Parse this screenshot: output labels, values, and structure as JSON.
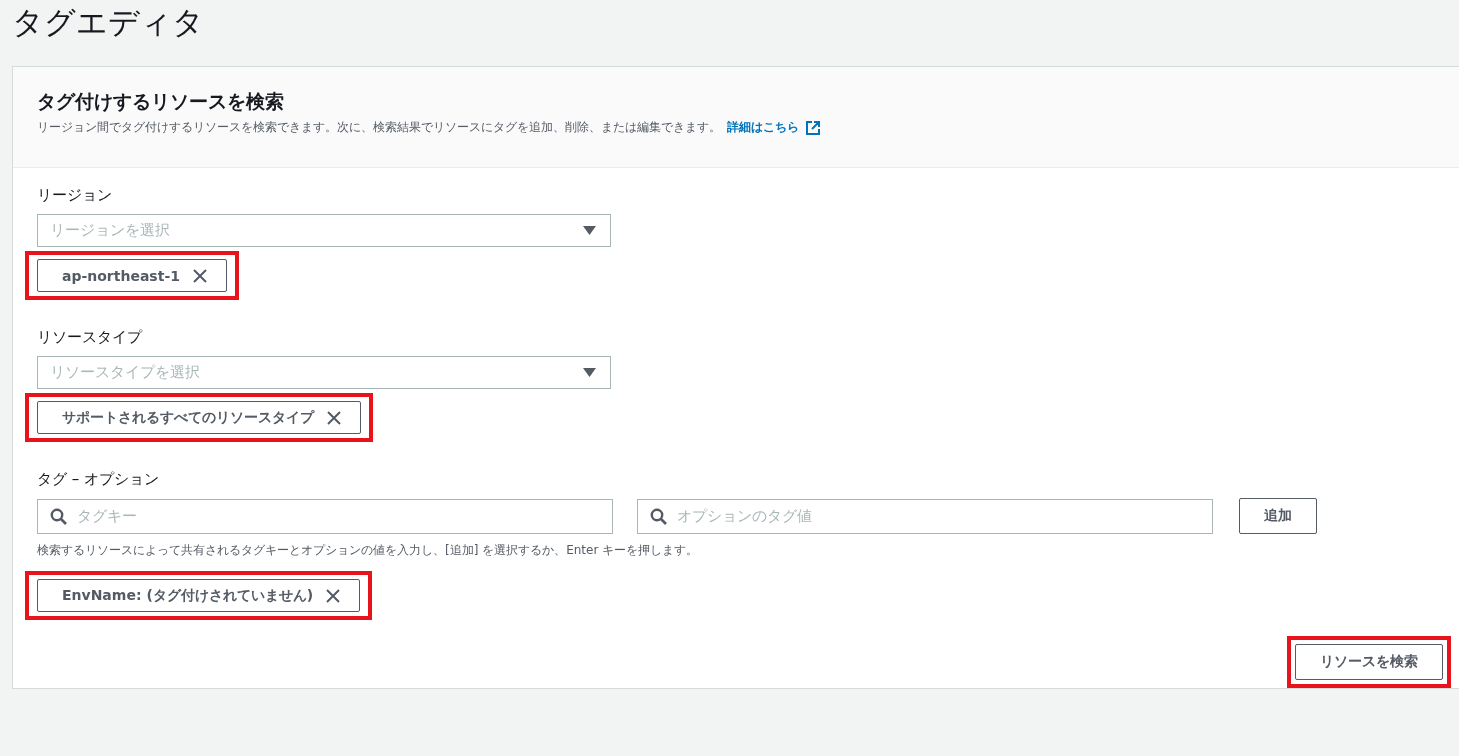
{
  "page_title": "タグエディタ",
  "panel": {
    "title": "タグ付けするリソースを検索",
    "description": "リージョン間でタグ付けするリソースを検索できます。次に、検索結果でリソースにタグを追加、削除、または編集できます。",
    "link": "詳細はこちら"
  },
  "region": {
    "label": "リージョン",
    "placeholder": "リージョンを選択",
    "tokens": [
      {
        "text": "ap-northeast-1",
        "highlighted": true
      }
    ]
  },
  "resource_type": {
    "label": "リソースタイプ",
    "placeholder": "リソースタイプを選択",
    "tokens": [
      {
        "text": "サポートされるすべてのリソースタイプ",
        "highlighted": true
      }
    ]
  },
  "tags": {
    "label": "タグ – オプション",
    "key_placeholder": "タグキー",
    "value_placeholder": "オプションのタグ値",
    "add_button": "追加",
    "hint": "検索するリソースによって共有されるタグキーとオプションの値を入力し、[追加] を選択するか、Enter キーを押します。",
    "tokens": [
      {
        "text": "EnvName: (タグ付けされていません)",
        "highlighted": true
      }
    ]
  },
  "search_button": {
    "label": "リソースを検索",
    "highlighted": true
  }
}
